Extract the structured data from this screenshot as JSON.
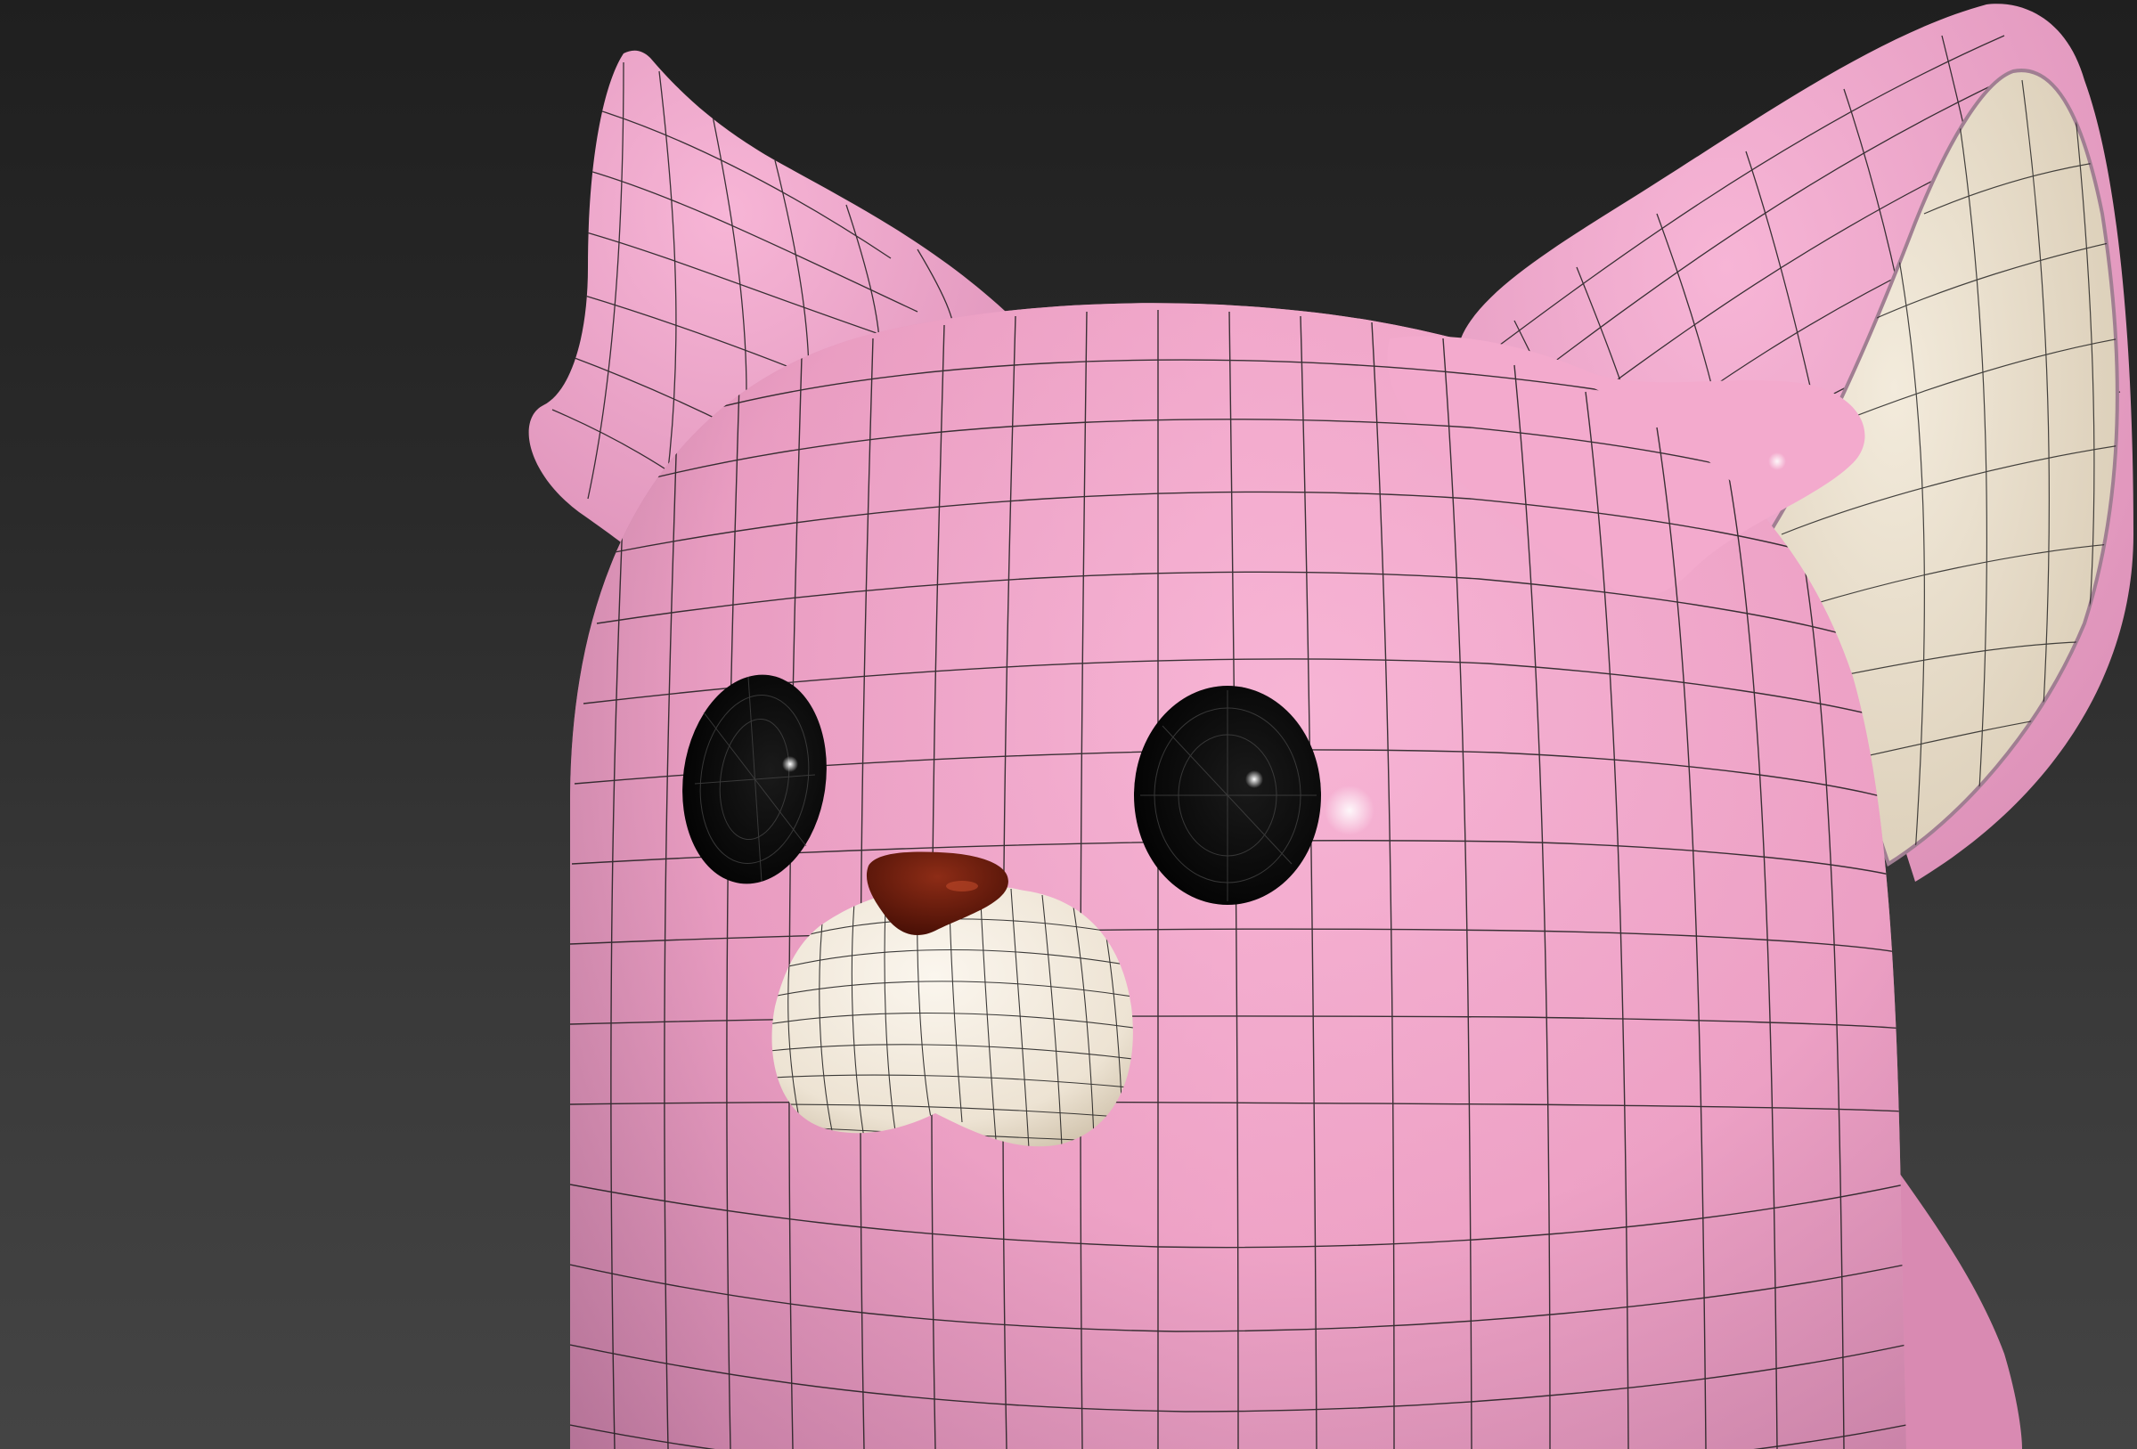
{
  "viewport": {
    "background_top": "#1f1f1f",
    "background_bottom": "#444444"
  },
  "model": {
    "body_color": "#f0a6c8",
    "body_shadow_color": "#b9769b",
    "inner_ear_color": "#e8ddc9",
    "muzzle_color": "#f4ede2",
    "nose_color": "#6b1b0c",
    "eye_color": "#050505",
    "wire_color": "#1b1b1b"
  },
  "icons": {
    "eye": "glossy-eye-icon",
    "nose": "nose-icon"
  }
}
